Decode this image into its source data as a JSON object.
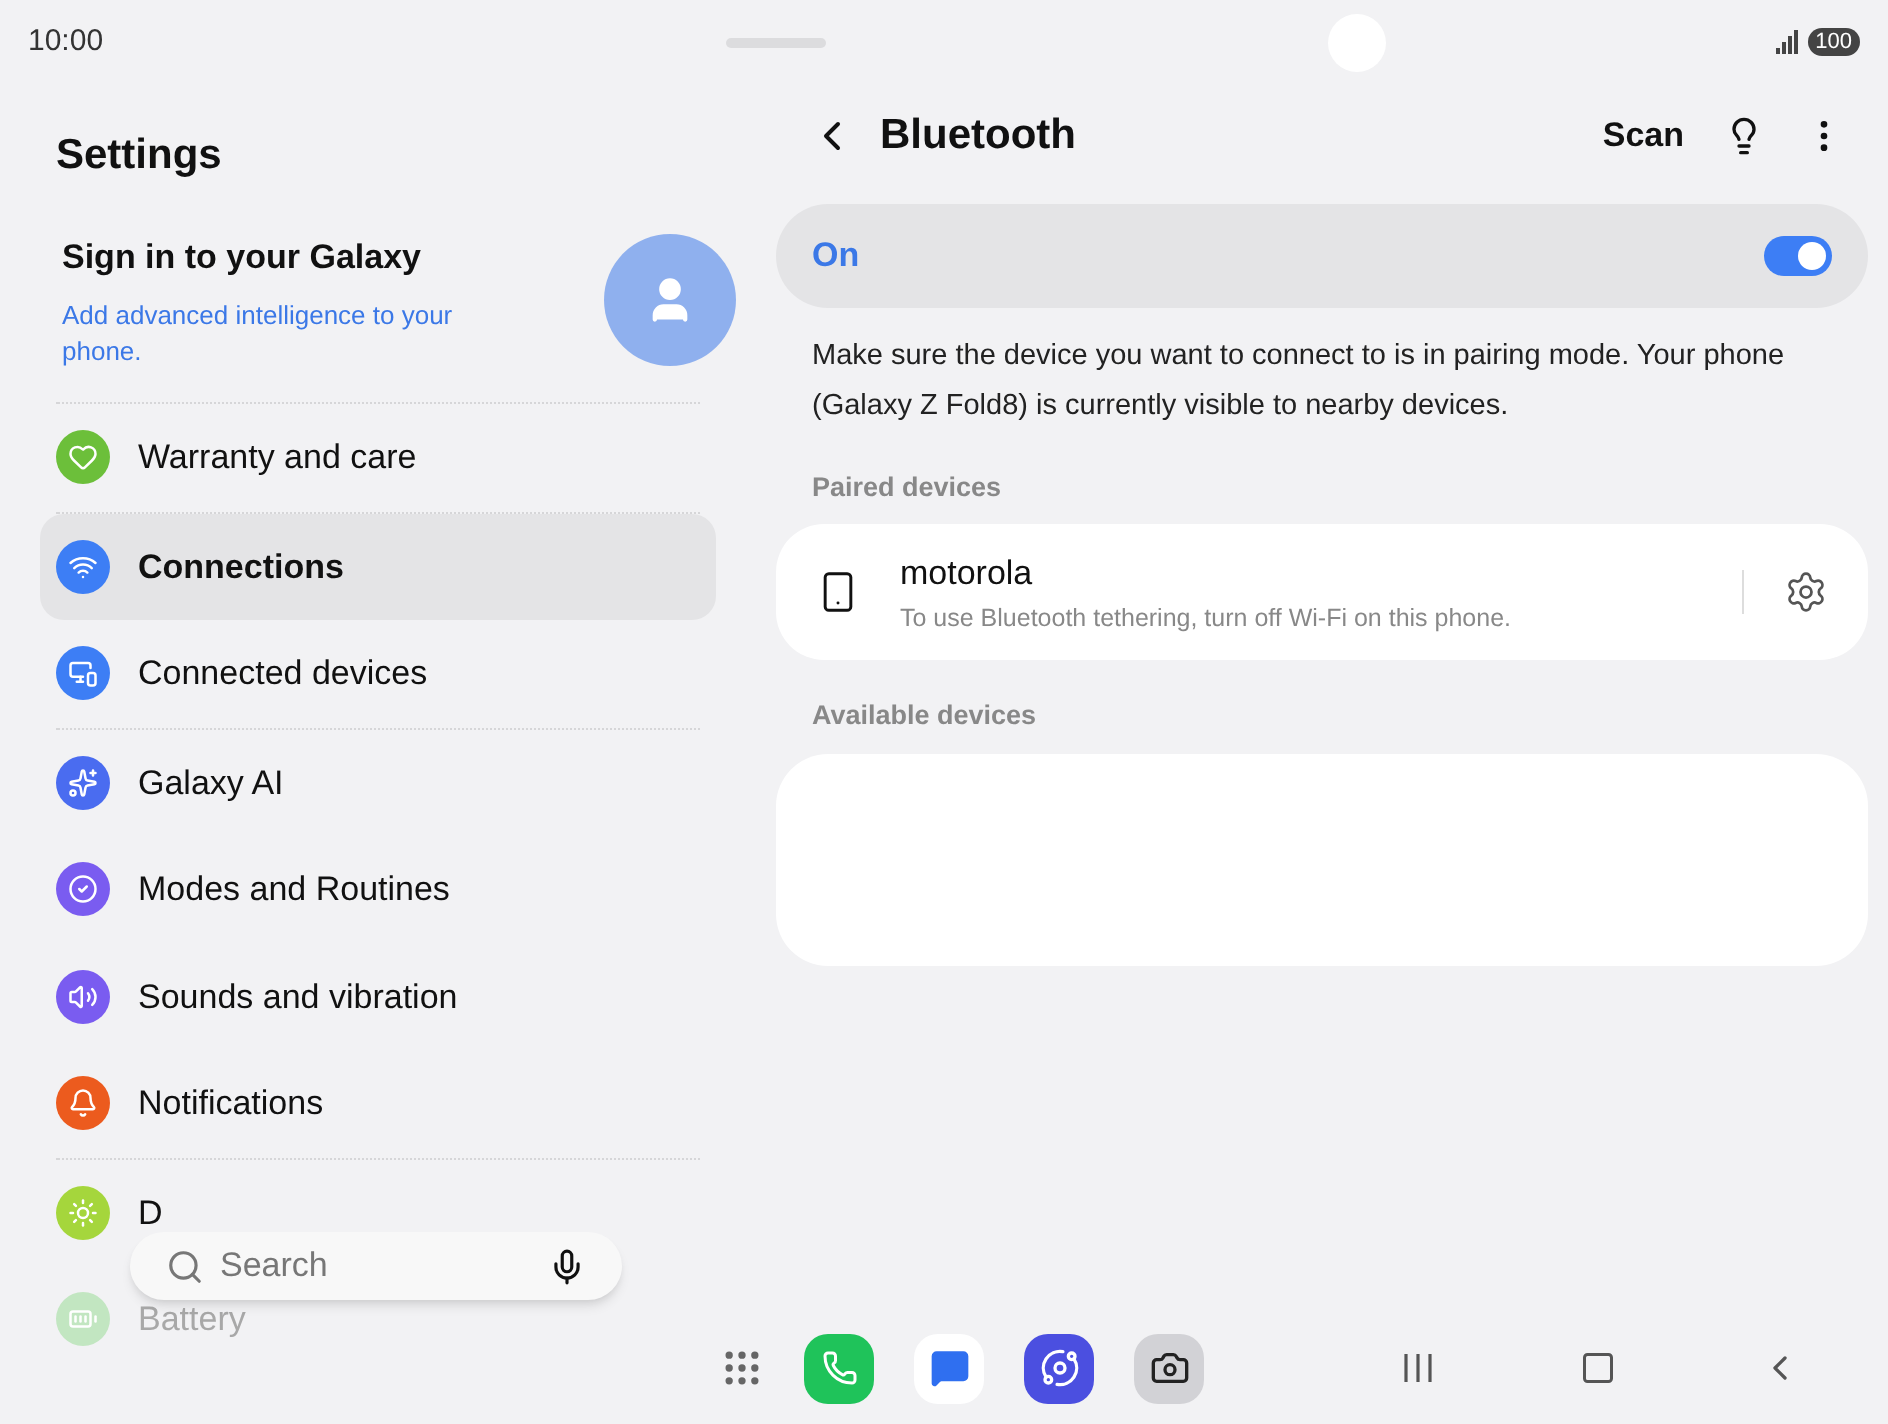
{
  "status_bar": {
    "time": "10:00",
    "battery": "100"
  },
  "sidebar": {
    "title": "Settings",
    "account": {
      "title": "Sign in to your Galaxy",
      "subtitle": "Add advanced intelligence to your phone."
    },
    "groups": [
      [
        {
          "label": "Warranty and care",
          "color": "#6cbf3a",
          "selected": false,
          "faded": false
        }
      ],
      [
        {
          "label": "Connections",
          "color": "#3d7ef5",
          "selected": true,
          "faded": false
        },
        {
          "label": "Connected devices",
          "color": "#3d7ef5",
          "selected": false,
          "faded": false
        }
      ],
      [
        {
          "label": "Galaxy AI",
          "color": "#4a6cf0",
          "selected": false,
          "faded": false
        },
        {
          "label": "Modes and Routines",
          "color": "#7a5cf0",
          "selected": false,
          "faded": false
        },
        {
          "label": "Sounds and vibration",
          "color": "#7a5cf0",
          "selected": false,
          "faded": false
        },
        {
          "label": "Notifications",
          "color": "#ec5b1e",
          "selected": false,
          "faded": false
        }
      ],
      [
        {
          "label": "D",
          "color": "#a5d63c",
          "selected": false,
          "faded": false
        },
        {
          "label": "Battery",
          "color": "#c2e6c1",
          "selected": false,
          "faded": true
        }
      ]
    ],
    "search": {
      "placeholder": "Search"
    }
  },
  "header": {
    "title": "Bluetooth",
    "action": "Scan"
  },
  "toggle": {
    "label": "On",
    "on": true
  },
  "description": "Make sure the device you want to connect to is in pairing mode. Your phone (Galaxy Z Fold8) is currently visible to nearby devices.",
  "paired": {
    "heading": "Paired devices",
    "devices": [
      {
        "name": "motorola",
        "note": "To use Bluetooth tethering, turn off Wi-Fi on this phone."
      }
    ]
  },
  "available": {
    "heading": "Available devices"
  }
}
